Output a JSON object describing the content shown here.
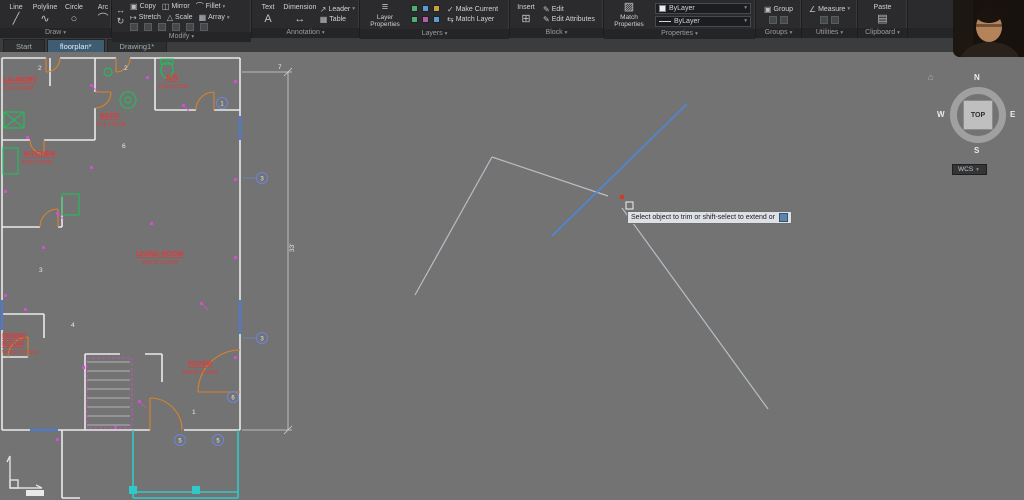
{
  "ribbon": {
    "draw": {
      "title": "Draw",
      "items": [
        "Line",
        "Polyline",
        "Circle",
        "Arc"
      ]
    },
    "modify": {
      "title": "Modify",
      "items": [
        "Copy",
        "Mirror",
        "Fillet",
        "Stretch",
        "Scale",
        "Array"
      ]
    },
    "annotation": {
      "title": "Annotation",
      "items": [
        "Text",
        "Dimension",
        "Leader",
        "Table"
      ]
    },
    "layers": {
      "title": "Layers",
      "main": "Layer Properties",
      "items": [
        "Make Current",
        "Match Layer"
      ]
    },
    "block": {
      "title": "Block",
      "main": "Insert",
      "items": [
        "Edit",
        "Edit Attributes"
      ]
    },
    "properties": {
      "title": "Properties",
      "main": "Match Properties",
      "color_value": "ByLayer",
      "linetype_value": "ByLayer"
    },
    "groups": {
      "title": "Groups",
      "main": "Group"
    },
    "utilities": {
      "title": "Utilities",
      "main": "Measure"
    },
    "clipboard": {
      "title": "Clipboard",
      "main": "Paste"
    }
  },
  "tabs": [
    {
      "label": "Start"
    },
    {
      "label": "floorplan*"
    },
    {
      "label": "Drawing1*"
    }
  ],
  "canvas": {
    "tooltip": "Select object to trim or shift-select to extend or"
  },
  "viewcube": {
    "n": "N",
    "s": "S",
    "e": "E",
    "w": "W",
    "top": "TOP",
    "wcs": "WCS"
  },
  "floorplan": {
    "rooms": [
      {
        "name": "LAUNDRY",
        "floor": "TILE FLOOR"
      },
      {
        "name": "B/R",
        "floor": "TILE FLOOR"
      },
      {
        "name": "BATH",
        "floor": "TILE FLOOR"
      },
      {
        "name": "KITCHEN",
        "floor": "TILE FLOOR"
      },
      {
        "name": "LIVING ROOM",
        "floor": "WOOD FLOOR"
      },
      {
        "name": "DINING",
        "name2": "ROOM",
        "floor": "WOOD FLOOR"
      },
      {
        "name": "FOYER",
        "floor": "WOOD FLOOR"
      }
    ],
    "keynotes": [
      "1",
      "3",
      "3",
      "6",
      "5",
      "5"
    ],
    "marks": [
      "2",
      "2",
      "6",
      "3",
      "4",
      "1"
    ],
    "dims": {
      "top": "7",
      "side": "33'"
    }
  },
  "colors": {
    "canvas_bg": "#737373",
    "wall": "#e9e9e9",
    "room_label": "#e03a3a",
    "door_arc": "#d9822b",
    "electrical": "#d24fd2",
    "fixture": "#27b85c",
    "window_accent": "#4f79d1",
    "porch": "#2fc9c9",
    "selected_line": "#4f86d8",
    "construction_line": "#b6bfc6",
    "active_tab": "#3e5d72"
  }
}
